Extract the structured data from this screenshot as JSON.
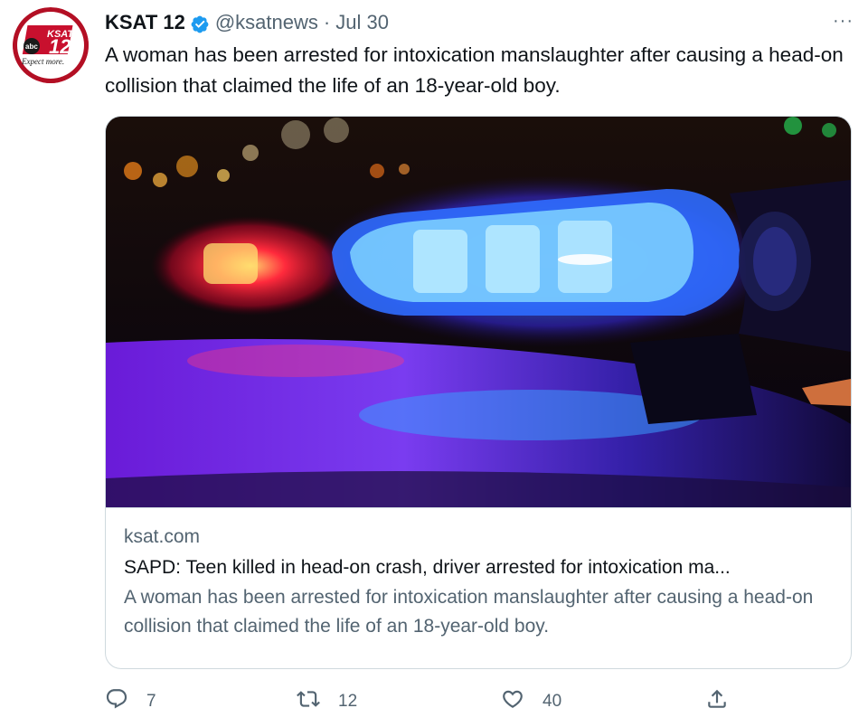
{
  "author": {
    "display_name": "KSAT 12",
    "handle": "@ksatnews",
    "separator": "·",
    "date": "Jul 30",
    "avatar_text": {
      "network": "abc",
      "station": "KSAT",
      "channel": "12",
      "tagline": "Expect more."
    }
  },
  "menu": {
    "more_label": "···"
  },
  "tweet": {
    "text": "A woman has been arrested for intoxication manslaughter after causing a head-on collision that claimed the life of an 18-year-old boy."
  },
  "card": {
    "domain": "ksat.com",
    "title": "SAPD: Teen killed in head-on crash, driver arrested for intoxication ma...",
    "description": "A woman has been arrested for intoxication manslaughter after causing a head-on collision that claimed the life of an 18-year-old boy."
  },
  "actions": {
    "replies": "7",
    "retweets": "12",
    "likes": "40"
  },
  "colors": {
    "verified": "#1d9bf0",
    "secondary_text": "#536471",
    "primary_text": "#0f1419",
    "border": "#cfd9de"
  }
}
